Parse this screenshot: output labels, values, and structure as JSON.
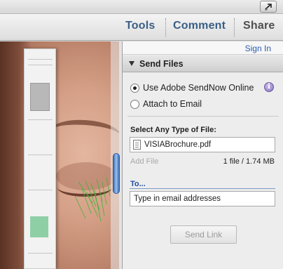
{
  "toolbar": {
    "tools": "Tools",
    "comment": "Comment",
    "share": "Share"
  },
  "icons": {
    "resize": "resize-arrow-icon",
    "panel_toggle": "triangle-down-icon",
    "info": "info-icon",
    "file": "pdf-file-icon"
  },
  "pane": {
    "sign_in": "Sign In",
    "panel_title": "Send Files",
    "option_sendnow": "Use Adobe SendNow Online",
    "option_attach": "Attach to Email",
    "info_glyph": "i",
    "select_label": "Select Any Type of File:",
    "file_name": "VISIABrochure.pdf",
    "add_file": "Add File",
    "file_count": "1 file / 1.74 MB",
    "to_label": "To...",
    "email_placeholder": "Type in email addresses",
    "send_button": "Send Link"
  },
  "colors": {
    "accent_link": "#2a5db0",
    "tab_text": "#3a5f86",
    "disabled_text": "#9b9b9b"
  }
}
